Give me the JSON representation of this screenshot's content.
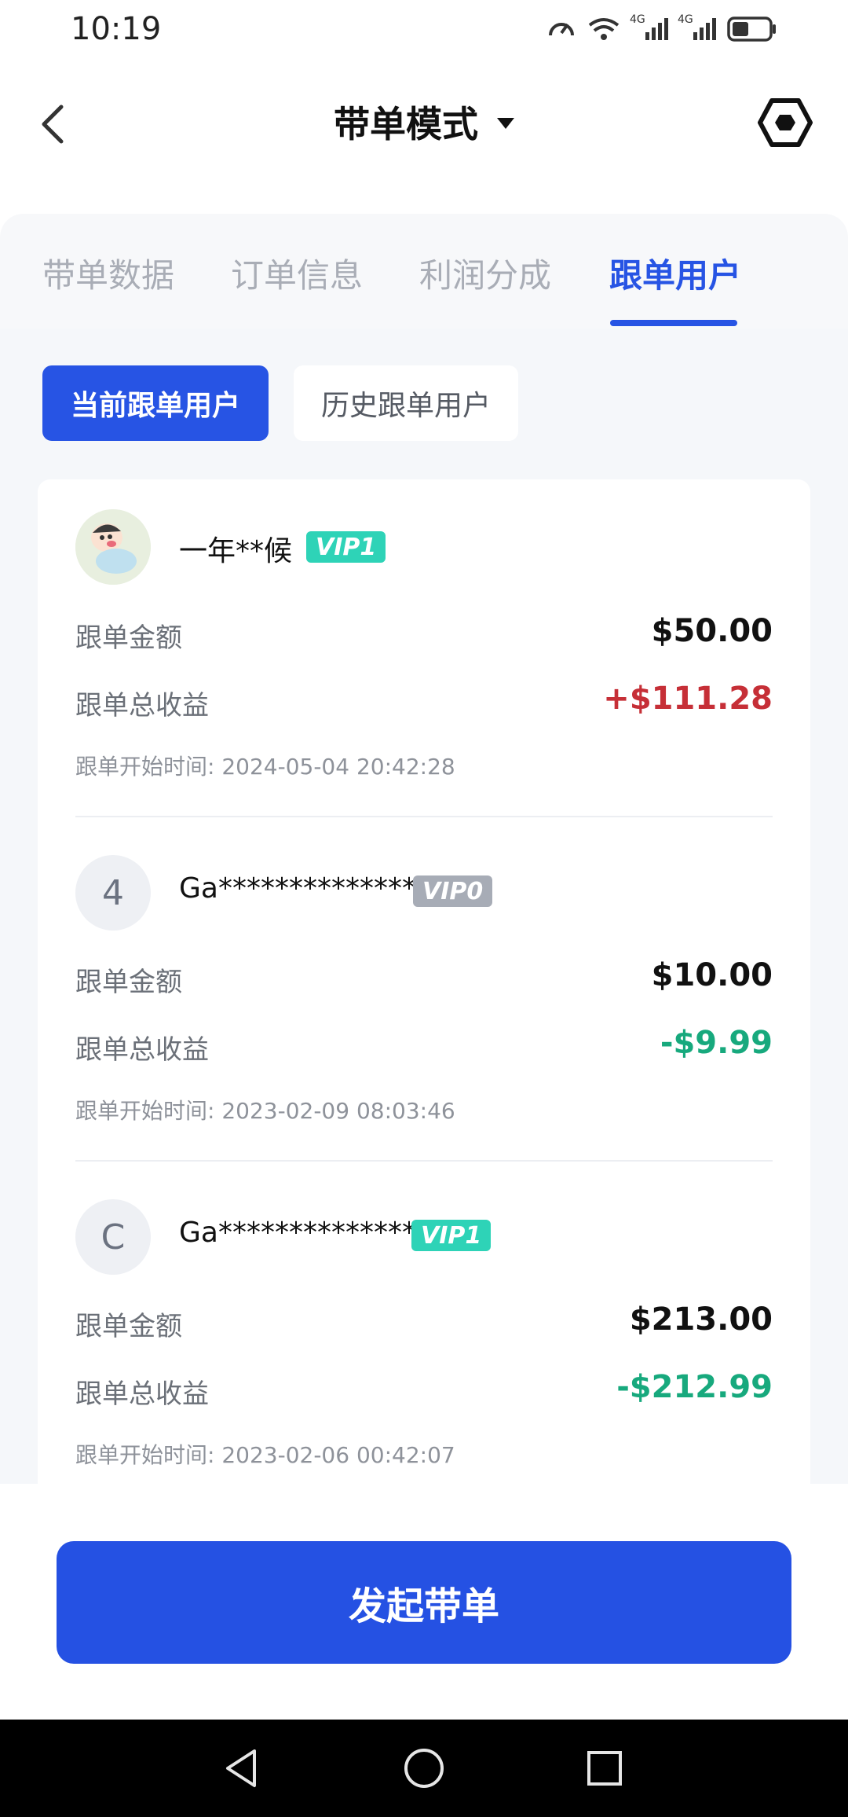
{
  "status_bar": {
    "time": "10:19",
    "icons": [
      "speedometer-icon",
      "wifi-icon",
      "signal-4g-icon",
      "signal-4g-icon",
      "battery-icon"
    ],
    "network_label_1": "4G",
    "network_label_2": "4G"
  },
  "header": {
    "title": "带单模式",
    "back_icon": "chevron-left-icon",
    "settings_icon": "hexagon-settings-icon"
  },
  "tabs": [
    {
      "label": "带单数据",
      "active": false
    },
    {
      "label": "订单信息",
      "active": false
    },
    {
      "label": "利润分成",
      "active": false
    },
    {
      "label": "跟单用户",
      "active": true
    }
  ],
  "subtabs": {
    "current": "当前跟单用户",
    "history": "历史跟单用户"
  },
  "followers": [
    {
      "avatar_text": "",
      "avatar_type": "cartoon-image",
      "name": "一年**候",
      "vip": "VIP1",
      "amount_label": "跟单金额",
      "amount": "$50.00",
      "profit_label": "跟单总收益",
      "profit": "+$111.28",
      "start_time": "跟单开始时间: 2024-05-04 20:42:28"
    },
    {
      "avatar_text": "4",
      "name": "Ga**************4",
      "vip": "VIP0",
      "amount_label": "跟单金额",
      "amount": "$10.00",
      "profit_label": "跟单总收益",
      "profit": "-$9.99",
      "start_time": "跟单开始时间: 2023-02-09 08:03:46"
    },
    {
      "avatar_text": "C",
      "name": "Ga**************c",
      "vip": "VIP1",
      "amount_label": "跟单金额",
      "amount": "$213.00",
      "profit_label": "跟单总收益",
      "profit": "-$212.99",
      "start_time": "跟单开始时间: 2023-02-06 00:42:07"
    }
  ],
  "primary_button": {
    "label": "发起带单"
  },
  "nav_bar": {
    "icons": [
      "back-triangle-icon",
      "home-circle-icon",
      "recents-square-icon"
    ]
  },
  "colors": {
    "accent": "#2754e4",
    "profit_positive": "#c62f37",
    "profit_negative": "#17a97d",
    "vip1": "#2ed3b7",
    "vip0": "#a7acb6"
  }
}
